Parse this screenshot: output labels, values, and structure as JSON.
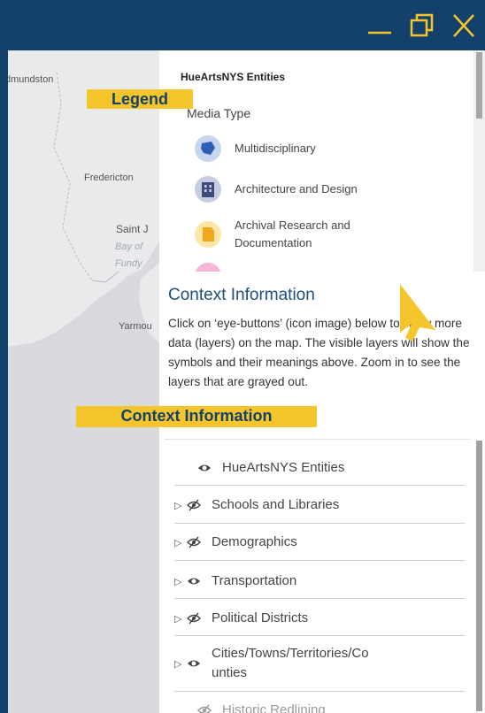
{
  "window": {
    "controls": {
      "minimize": "minimize",
      "maximize": "restore",
      "close": "close"
    }
  },
  "map": {
    "labels": {
      "edmundston": "dmundston",
      "fredericton": "Fredericton",
      "saint_john": "Saint J",
      "bay_of_fundy_1": "Bay of",
      "bay_of_fundy_2": "Fundy",
      "yarmouth": "Yarmou"
    }
  },
  "legend": {
    "title": "HueArtsNYS Entities",
    "subtitle": "Media Type",
    "items": [
      {
        "label": "Multidisciplinary",
        "color": "#2f5fb5",
        "bg": "#c7d5ee",
        "icon": "multidisciplinary-icon"
      },
      {
        "label": "Architecture and Design",
        "color": "#3d4a7a",
        "bg": "#c7cde0",
        "icon": "building-icon"
      },
      {
        "label": "Archival Research and Documentation",
        "color": "#f0a81e",
        "bg": "#fde6a6",
        "icon": "archive-icon"
      }
    ],
    "tag": "Legend"
  },
  "context": {
    "heading": "Context Information",
    "body": "Click on ‘eye-buttons’ (icon image) below to show more data (layers) on the map. The visible layers will show the symbols and their meanings above. Zoom in to see the layers that are grayed out.",
    "tag": "Context Information"
  },
  "layers": [
    {
      "label": "HueArtsNYS Entities",
      "expandable": false,
      "visible": true,
      "grayed": false
    },
    {
      "label": "Schools and Libraries",
      "expandable": true,
      "visible": false,
      "grayed": false
    },
    {
      "label": "Demographics",
      "expandable": true,
      "visible": false,
      "grayed": false
    },
    {
      "label": "Transportation",
      "expandable": true,
      "visible": true,
      "grayed": false
    },
    {
      "label": "Political Districts",
      "expandable": true,
      "visible": false,
      "grayed": false
    },
    {
      "label": "Cities/Towns/Territories/Co unties",
      "expandable": true,
      "visible": true,
      "grayed": false
    },
    {
      "label": "Historic Redlining",
      "expandable": false,
      "visible": false,
      "grayed": true
    }
  ],
  "colors": {
    "titlebar": "#14416b",
    "tag": "#f5c62c",
    "cursor": "#f5c62c",
    "heading": "#1f4f7a"
  }
}
